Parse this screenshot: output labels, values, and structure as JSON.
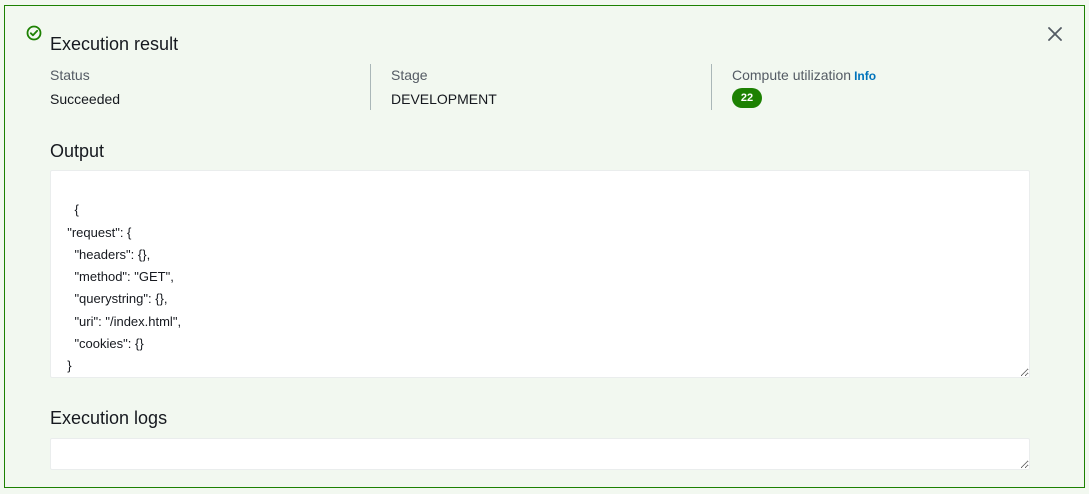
{
  "result": {
    "title": "Execution result",
    "status_label": "Status",
    "status_value": "Succeeded",
    "stage_label": "Stage",
    "stage_value": "DEVELOPMENT",
    "compute_label": "Compute utilization",
    "info_link": "Info",
    "compute_value": "22"
  },
  "output": {
    "title": "Output",
    "text": "{\n  \"request\": {\n    \"headers\": {},\n    \"method\": \"GET\",\n    \"querystring\": {},\n    \"uri\": \"/index.html\",\n    \"cookies\": {}\n  }\n}"
  },
  "logs": {
    "title": "Execution logs",
    "text": ""
  },
  "colors": {
    "success": "#1d8102",
    "link": "#0073bb",
    "panel_bg": "#f2f8f0"
  },
  "icons": {
    "status": "check-circle-icon",
    "close": "close-icon",
    "resize": "resize-handle-icon"
  }
}
